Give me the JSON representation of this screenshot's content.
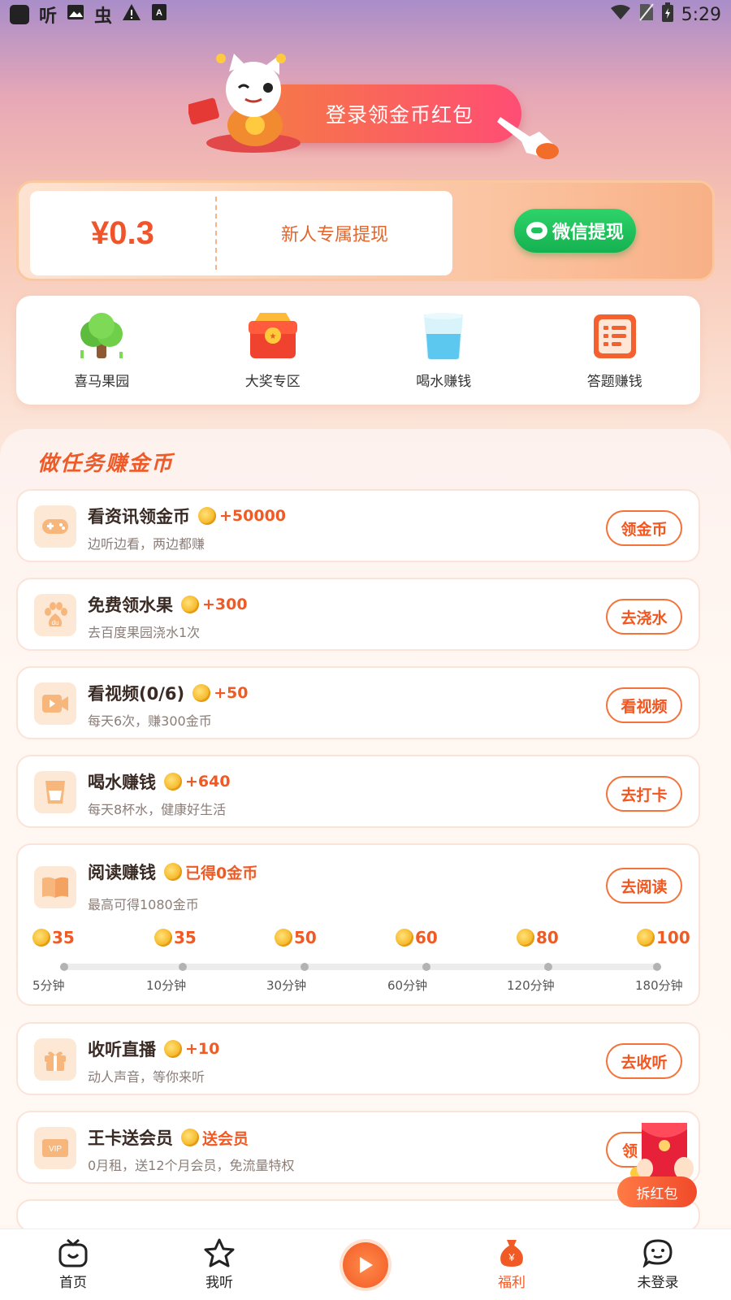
{
  "status_bar": {
    "left_icons": [
      "app-square-icon",
      "ting-icon",
      "image-icon",
      "bug-icon",
      "warning-icon",
      "font-icon"
    ],
    "left_glyphs": [
      "听",
      "虫"
    ],
    "time": "5:29",
    "right_icons": [
      "wifi-icon",
      "no-sim-icon",
      "battery-icon"
    ]
  },
  "banner": {
    "label": "登录领金币红包"
  },
  "withdraw": {
    "amount": "¥0.3",
    "description": "新人专属提现",
    "button_label": "微信提现"
  },
  "features": [
    {
      "label": "喜马果园",
      "icon": "tree-icon"
    },
    {
      "label": "大奖专区",
      "icon": "treasure-box-icon"
    },
    {
      "label": "喝水赚钱",
      "icon": "water-glass-icon"
    },
    {
      "label": "答题赚钱",
      "icon": "quiz-note-icon"
    }
  ],
  "tasks_section": {
    "title": "做任务赚金币",
    "tasks": [
      {
        "name": "看资讯领金币",
        "reward": "+50000",
        "subtitle": "边听边看，两边都赚",
        "button": "领金币",
        "icon": "gamepad-icon"
      },
      {
        "name": "免费领水果",
        "reward": "+300",
        "subtitle": "去百度果园浇水1次",
        "button": "去浇水",
        "icon": "baidu-paw-icon"
      },
      {
        "name": "看视频(0/6)",
        "reward": "+50",
        "subtitle": "每天6次，赚300金币",
        "button": "看视频",
        "icon": "video-icon"
      },
      {
        "name": "喝水赚钱",
        "reward": "+640",
        "subtitle": "每天8杯水，健康好生活",
        "button": "去打卡",
        "icon": "cup-icon"
      }
    ],
    "reading": {
      "name": "阅读赚钱",
      "reward": "已得0金币",
      "subtitle": "最高可得1080金币",
      "button": "去阅读",
      "icon": "book-icon",
      "milestones": [
        {
          "coins": "35",
          "time": "5分钟"
        },
        {
          "coins": "35",
          "time": "10分钟"
        },
        {
          "coins": "50",
          "time": "30分钟"
        },
        {
          "coins": "60",
          "time": "60分钟"
        },
        {
          "coins": "80",
          "time": "120分钟"
        },
        {
          "coins": "100",
          "time": "180分钟"
        }
      ],
      "progress": 0
    },
    "tasks2": [
      {
        "name": "收听直播",
        "reward": "+10",
        "subtitle": "动人声音，等你来听",
        "button": "去收听",
        "icon": "gift-icon"
      },
      {
        "name": "王卡送会员",
        "reward": "送会员",
        "subtitle": "0月租，送12个月会员，免流量特权",
        "button": "领",
        "icon": "vip-icon"
      }
    ]
  },
  "floating_red_packet": {
    "label": "拆红包"
  },
  "bottom_nav": [
    {
      "label": "首页",
      "icon": "tv-home-icon",
      "active": false
    },
    {
      "label": "我听",
      "icon": "star-icon",
      "active": false
    },
    {
      "label": "",
      "icon": "play-icon",
      "active": false
    },
    {
      "label": "福利",
      "icon": "money-bag-icon",
      "active": true
    },
    {
      "label": "未登录",
      "icon": "chat-face-icon",
      "active": false
    }
  ],
  "colors": {
    "accent": "#f05a24",
    "wechat_green": "#1ec15c",
    "brand_pink": "#ff4d74"
  }
}
